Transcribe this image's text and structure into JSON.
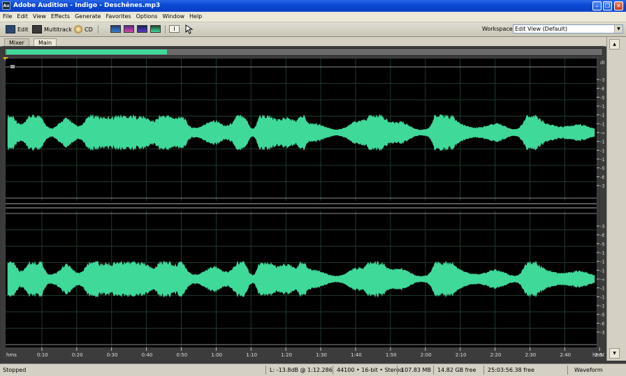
{
  "window": {
    "title": "Adobe Audition - Indigo - Deschênes.mp3",
    "icon_label": "Au",
    "buttons": [
      "minimize",
      "maximize",
      "close"
    ]
  },
  "menu": [
    "File",
    "Edit",
    "View",
    "Effects",
    "Generate",
    "Favorites",
    "Options",
    "Window",
    "Help"
  ],
  "toolbar": {
    "edit_label": "Edit",
    "multitrack_label": "Multitrack",
    "cd_label": "CD",
    "workspace_label": "Workspace:",
    "workspace_value": "Edit View (Default)"
  },
  "tabs": [
    {
      "label": "Mixer",
      "active": false
    },
    {
      "label": "Main",
      "active": true
    }
  ],
  "overview": {
    "visible_fraction": 0.27
  },
  "colors": {
    "waveform": "#3fd99a",
    "background": "#000000",
    "grid": "#1e3b2c",
    "ruler": "#3c3c3c"
  },
  "db_scale": {
    "top_label": "dB",
    "channel_labels": [
      "-3",
      "-6",
      "-9",
      "-12",
      "-15",
      "-18",
      "-∞",
      "-18",
      "-15",
      "-12",
      "-9",
      "-6",
      "-3"
    ]
  },
  "time_ruler": {
    "unit": "hms",
    "ticks": [
      "0:10",
      "0:20",
      "0:30",
      "0:40",
      "0:50",
      "1:00",
      "1:10",
      "1:20",
      "1:30",
      "1:40",
      "1:50",
      "2:00",
      "2:10",
      "2:20",
      "2:30",
      "2:40",
      "2:50"
    ],
    "end_label": "hms"
  },
  "status": {
    "state": "Stopped",
    "level": "L: -13.8dB @",
    "position": "1:12.286",
    "format": "44100 • 16-bit • Stereo",
    "file_size": "107.83 MB",
    "disk_free": "14.82 GB free",
    "time_free": "25:03:56.38 free",
    "view": "Waveform"
  }
}
